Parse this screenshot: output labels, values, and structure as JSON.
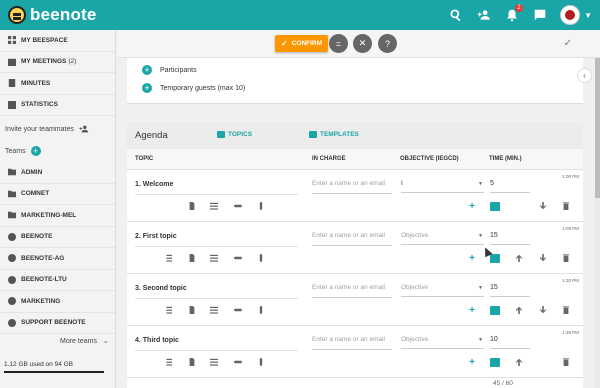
{
  "app": {
    "name": "beenote"
  },
  "header": {
    "notification_count": "2",
    "icons": [
      "search-icon",
      "add-user-icon",
      "bell-icon",
      "chat-icon",
      "avatar"
    ]
  },
  "sidebar": {
    "items": [
      {
        "label": "MY BEESPACE",
        "icon": "grid-icon"
      },
      {
        "label": "MY MEETINGS",
        "count": "(2)",
        "icon": "calendar-icon"
      },
      {
        "label": "MINUTES",
        "icon": "document-icon"
      },
      {
        "label": "STATISTICS",
        "icon": "chart-icon"
      }
    ],
    "invite_label": "Invite your teammates",
    "teams_label": "Teams",
    "teams": [
      {
        "label": "ADMIN",
        "icon": "folder-icon"
      },
      {
        "label": "COMNET",
        "icon": "folder-icon"
      },
      {
        "label": "MARKETING-MEL",
        "icon": "folder-icon"
      },
      {
        "label": "BEENOTE",
        "icon": "team-icon"
      },
      {
        "label": "BEENOTE-AG",
        "icon": "team-icon"
      },
      {
        "label": "BEENOTE-LTU",
        "icon": "team-icon"
      },
      {
        "label": "MARKETING",
        "icon": "team-icon"
      },
      {
        "label": "SUPPORT BEENOTE",
        "icon": "team-icon"
      }
    ],
    "more_teams": "More teams",
    "storage": "1.12 GB used on 94 GB"
  },
  "toolbar": {
    "confirm_label": "CONFIRM"
  },
  "participants": {
    "participants_label": "Participants",
    "guests_label": "Temporary guests (max 10)"
  },
  "agenda": {
    "title": "Agenda",
    "tab_topics": "TOPICS",
    "tab_templates": "TEMPLATES",
    "columns": {
      "topic": "TOPIC",
      "in_charge": "IN CHARGE",
      "objective": "OBJECTIVE (IEGCD)",
      "time": "TIME (MIN.)"
    },
    "topics": [
      {
        "title": "1. Welcome",
        "in_charge_placeholder": "Enter a name or an email",
        "objective": "I",
        "time": "5",
        "clock": "1:00 PM"
      },
      {
        "title": "2. First topic",
        "in_charge_placeholder": "Enter a name or an email",
        "objective": "Objective",
        "time": "15",
        "clock": "1:05 PM"
      },
      {
        "title": "3. Second topic",
        "in_charge_placeholder": "Enter a name or an email",
        "objective": "Objective",
        "time": "15",
        "clock": "1:20 PM"
      },
      {
        "title": "4. Third topic",
        "in_charge_placeholder": "Enter a name or an email",
        "objective": "Objective",
        "time": "10",
        "clock": "1:35 PM"
      }
    ],
    "footer_count": "45 / 60"
  }
}
